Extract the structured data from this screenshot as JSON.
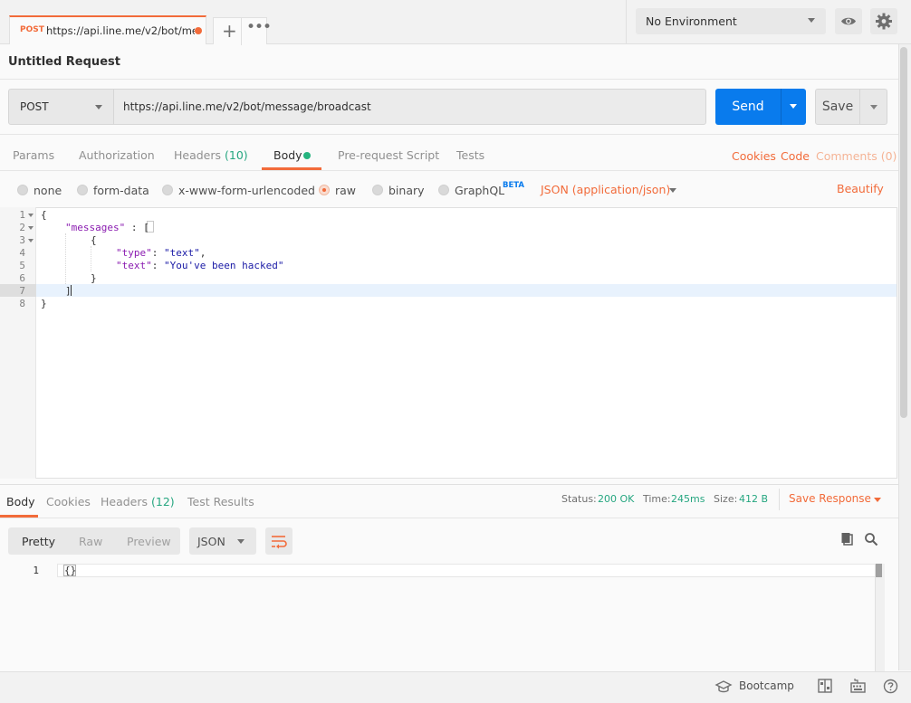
{
  "tabs": {
    "active": {
      "method": "POST",
      "url": "https://api.line.me/v2/bot/me..."
    }
  },
  "environment": {
    "selected": "No Environment"
  },
  "request": {
    "name": "Untitled Request",
    "method": "POST",
    "url": "https://api.line.me/v2/bot/message/broadcast",
    "send_label": "Send",
    "save_label": "Save"
  },
  "request_tabs": {
    "params": "Params",
    "authorization": "Authorization",
    "headers": "Headers",
    "headers_count": "(10)",
    "body": "Body",
    "prerequest": "Pre-request Script",
    "tests": "Tests",
    "cookies": "Cookies",
    "code": "Code",
    "comments": "Comments (0)"
  },
  "body_options": {
    "none": "none",
    "form_data": "form-data",
    "urlencoded": "x-www-form-urlencoded",
    "raw": "raw",
    "binary": "binary",
    "graphql": "GraphQL",
    "beta": "BETA",
    "content_type": "JSON (application/json)",
    "beautify": "Beautify",
    "selected": "raw"
  },
  "editor": {
    "line_numbers": [
      "1",
      "2",
      "3",
      "4",
      "5",
      "6",
      "7",
      "8"
    ],
    "l1": "{",
    "l2_key": "\"messages\"",
    "l2_rest": " : [",
    "l3": "{",
    "l4_key": "\"type\"",
    "l4_sep": ": ",
    "l4_val": "\"text\"",
    "l4_end": ",",
    "l5_key": "\"text\"",
    "l5_sep": ": ",
    "l5_val": "\"You've been hacked\"",
    "l6": "}",
    "l7": "]",
    "l8": "}"
  },
  "response_tabs": {
    "body": "Body",
    "cookies": "Cookies",
    "headers": "Headers",
    "headers_count": "(12)",
    "test_results": "Test Results"
  },
  "response_status": {
    "status_label": "Status:",
    "status_value": "200 OK",
    "time_label": "Time:",
    "time_value": "245ms",
    "size_label": "Size:",
    "size_value": "412 B",
    "save_response": "Save Response"
  },
  "response_view": {
    "pretty": "Pretty",
    "raw": "Raw",
    "preview": "Preview",
    "format": "JSON",
    "line_number": "1",
    "content": "{}"
  },
  "statusbar": {
    "bootcamp": "Bootcamp"
  },
  "colors": {
    "accent": "#f26b3a",
    "send": "#097bed",
    "success": "#26a680"
  }
}
